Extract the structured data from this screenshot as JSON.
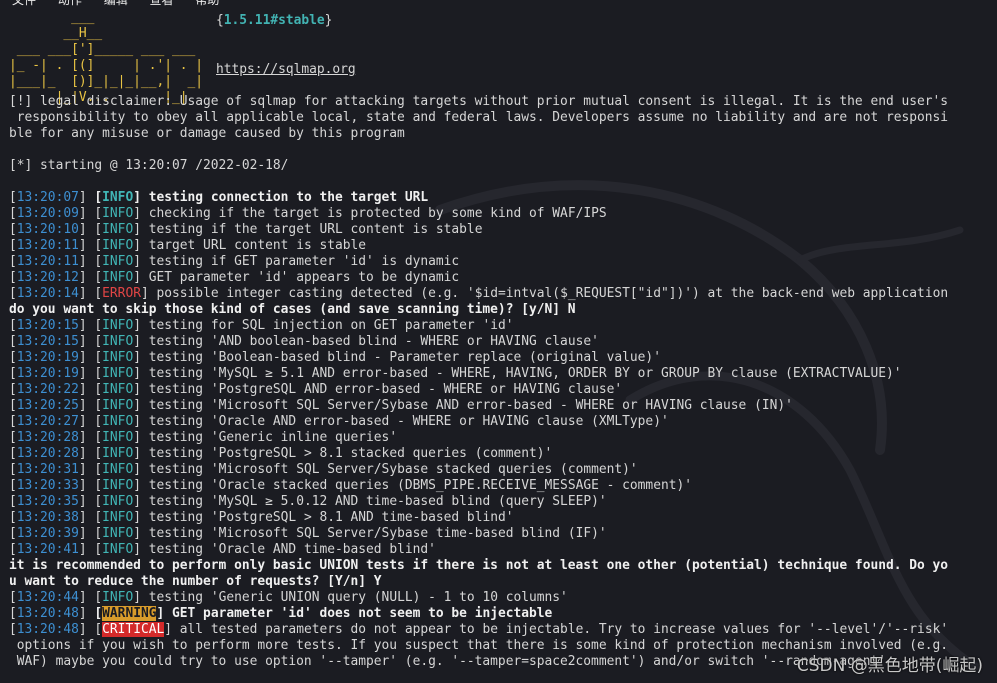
{
  "menu": [
    "文件",
    "动作",
    "编辑",
    "查看",
    "帮助"
  ],
  "logo": {
    "lines": [
      "        ___",
      "       __H__",
      " ___ ___[']_____ ___ ___",
      "|_ -| . [(]     | .'| . |",
      "|___|_  [)]_|_|_|__,|  _|",
      "      |_|V...       |_|"
    ],
    "version": "1.5.11#stable",
    "url": "https://sqlmap.org"
  },
  "lines": [
    {
      "kind": "plain",
      "text": "[!] legal disclaimer: Usage of sqlmap for attacking targets without prior mutual consent is illegal. It is the end user's"
    },
    {
      "kind": "plain",
      "text": " responsibility to obey all applicable local, state and federal laws. Developers assume no liability and are not responsi"
    },
    {
      "kind": "plain",
      "text": "ble for any misuse or damage caused by this program"
    },
    {
      "kind": "plain",
      "text": ""
    },
    {
      "kind": "plain",
      "text": "[*] starting @ 13:20:07 /2022-02-18/"
    },
    {
      "kind": "plain",
      "text": ""
    },
    {
      "kind": "log",
      "ts": "13:20:07",
      "level": "INFO",
      "style": "info-bold",
      "text": "testing connection to the target URL"
    },
    {
      "kind": "log",
      "ts": "13:20:09",
      "level": "INFO",
      "style": "info",
      "text": "checking if the target is protected by some kind of WAF/IPS"
    },
    {
      "kind": "log",
      "ts": "13:20:10",
      "level": "INFO",
      "style": "info",
      "text": "testing if the target URL content is stable"
    },
    {
      "kind": "log",
      "ts": "13:20:11",
      "level": "INFO",
      "style": "info",
      "text": "target URL content is stable"
    },
    {
      "kind": "log",
      "ts": "13:20:11",
      "level": "INFO",
      "style": "info",
      "text": "testing if GET parameter 'id' is dynamic"
    },
    {
      "kind": "log",
      "ts": "13:20:12",
      "level": "INFO",
      "style": "info",
      "text": "GET parameter 'id' appears to be dynamic"
    },
    {
      "kind": "log",
      "ts": "13:20:14",
      "level": "ERROR",
      "style": "error",
      "text": "possible integer casting detected (e.g. '$id=intval($_REQUEST[\"id\"])') at the back-end web application"
    },
    {
      "kind": "prompt",
      "text": "do you want to skip those kind of cases (and save scanning time)? [y/N] N"
    },
    {
      "kind": "log",
      "ts": "13:20:15",
      "level": "INFO",
      "style": "info",
      "text": "testing for SQL injection on GET parameter 'id'"
    },
    {
      "kind": "log",
      "ts": "13:20:15",
      "level": "INFO",
      "style": "info",
      "text": "testing 'AND boolean-based blind - WHERE or HAVING clause'"
    },
    {
      "kind": "log",
      "ts": "13:20:19",
      "level": "INFO",
      "style": "info",
      "text": "testing 'Boolean-based blind - Parameter replace (original value)'"
    },
    {
      "kind": "log",
      "ts": "13:20:19",
      "level": "INFO",
      "style": "info",
      "text": "testing 'MySQL ≥ 5.1 AND error-based - WHERE, HAVING, ORDER BY or GROUP BY clause (EXTRACTVALUE)'"
    },
    {
      "kind": "log",
      "ts": "13:20:22",
      "level": "INFO",
      "style": "info",
      "text": "testing 'PostgreSQL AND error-based - WHERE or HAVING clause'"
    },
    {
      "kind": "log",
      "ts": "13:20:25",
      "level": "INFO",
      "style": "info",
      "text": "testing 'Microsoft SQL Server/Sybase AND error-based - WHERE or HAVING clause (IN)'"
    },
    {
      "kind": "log",
      "ts": "13:20:27",
      "level": "INFO",
      "style": "info",
      "text": "testing 'Oracle AND error-based - WHERE or HAVING clause (XMLType)'"
    },
    {
      "kind": "log",
      "ts": "13:20:28",
      "level": "INFO",
      "style": "info",
      "text": "testing 'Generic inline queries'"
    },
    {
      "kind": "log",
      "ts": "13:20:28",
      "level": "INFO",
      "style": "info",
      "text": "testing 'PostgreSQL > 8.1 stacked queries (comment)'"
    },
    {
      "kind": "log",
      "ts": "13:20:31",
      "level": "INFO",
      "style": "info",
      "text": "testing 'Microsoft SQL Server/Sybase stacked queries (comment)'"
    },
    {
      "kind": "log",
      "ts": "13:20:33",
      "level": "INFO",
      "style": "info",
      "text": "testing 'Oracle stacked queries (DBMS_PIPE.RECEIVE_MESSAGE - comment)'"
    },
    {
      "kind": "log",
      "ts": "13:20:35",
      "level": "INFO",
      "style": "info",
      "text": "testing 'MySQL ≥ 5.0.12 AND time-based blind (query SLEEP)'"
    },
    {
      "kind": "log",
      "ts": "13:20:38",
      "level": "INFO",
      "style": "info",
      "text": "testing 'PostgreSQL > 8.1 AND time-based blind'"
    },
    {
      "kind": "log",
      "ts": "13:20:39",
      "level": "INFO",
      "style": "info",
      "text": "testing 'Microsoft SQL Server/Sybase time-based blind (IF)'"
    },
    {
      "kind": "log",
      "ts": "13:20:41",
      "level": "INFO",
      "style": "info",
      "text": "testing 'Oracle AND time-based blind'"
    },
    {
      "kind": "prompt",
      "text": "it is recommended to perform only basic UNION tests if there is not at least one other (potential) technique found. Do yo"
    },
    {
      "kind": "prompt",
      "text": "u want to reduce the number of requests? [Y/n] Y"
    },
    {
      "kind": "log",
      "ts": "13:20:44",
      "level": "INFO",
      "style": "info",
      "text": "testing 'Generic UNION query (NULL) - 1 to 10 columns'"
    },
    {
      "kind": "log",
      "ts": "13:20:48",
      "level": "WARNING",
      "style": "warning",
      "text": "GET parameter 'id' does not seem to be injectable"
    },
    {
      "kind": "log",
      "ts": "13:20:48",
      "level": "CRITICAL",
      "style": "critical",
      "text": "all tested parameters do not appear to be injectable. Try to increase values for '--level'/'--risk'"
    },
    {
      "kind": "plain",
      "text": " options if you wish to perform more tests. If you suspect that there is some kind of protection mechanism involved (e.g."
    },
    {
      "kind": "plain",
      "text": " WAF) maybe you could try to use option '--tamper' (e.g. '--tamper=space2comment') and/or switch '--random-agent'"
    }
  ],
  "watermark": "CSDN @黑色地带(崛起)",
  "colors": {
    "background": "#1b1c22",
    "timestamp": "#3d8fd1",
    "info": "#41b6b6",
    "error": "#e04545",
    "warning_bg": "#d99c2b",
    "critical_bg": "#d42a2a",
    "logo": "#e8c344"
  }
}
